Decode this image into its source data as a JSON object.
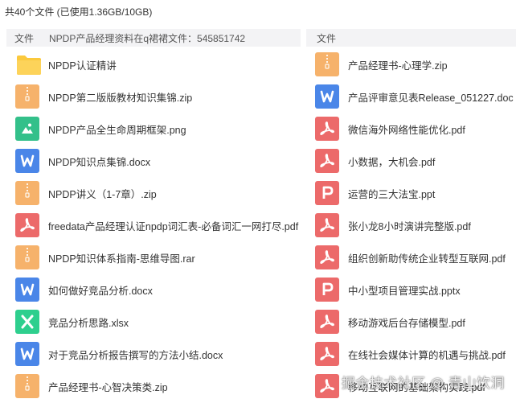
{
  "summary": "共40个文件 (已使用1.36GB/10GB)",
  "left_header": {
    "label": "文件",
    "overlay": "NPDP产品经理资料在q裙裙文件：545851742"
  },
  "right_header": {
    "label": "文件"
  },
  "left_files": [
    {
      "name": "NPDP认证精讲",
      "type": "folder"
    },
    {
      "name": "NPDP第二版版教材知识集锦.zip",
      "type": "zip"
    },
    {
      "name": "NPDP产品全生命周期框架.png",
      "type": "png"
    },
    {
      "name": "NPDP知识点集锦.docx",
      "type": "word"
    },
    {
      "name": "NPDP讲义（1-7章）.zip",
      "type": "zip"
    },
    {
      "name": "freedata产品经理认证npdp词汇表-必备词汇一网打尽.pdf",
      "type": "pdf"
    },
    {
      "name": "NPDP知识体系指南-思维导图.rar",
      "type": "zip"
    },
    {
      "name": "如何做好竞品分析.docx",
      "type": "word"
    },
    {
      "name": "竞品分析思路.xlsx",
      "type": "xls"
    },
    {
      "name": "对于竞品分析报告撰写的方法小结.docx",
      "type": "word"
    },
    {
      "name": "产品经理书-心智决策类.zip",
      "type": "zip"
    }
  ],
  "right_files": [
    {
      "name": "产品经理书-心理学.zip",
      "type": "zip"
    },
    {
      "name": "产品评审意见表Release_051227.doc",
      "type": "word"
    },
    {
      "name": "微信海外网络性能优化.pdf",
      "type": "pdf"
    },
    {
      "name": "小数据，大机会.pdf",
      "type": "pdf"
    },
    {
      "name": "运营的三大法宝.ppt",
      "type": "ppt"
    },
    {
      "name": "张小龙8小时演讲完整版.pdf",
      "type": "pdf"
    },
    {
      "name": "组织创新助传统企业转型互联网.pdf",
      "type": "pdf"
    },
    {
      "name": "中小型项目管理实战.pptx",
      "type": "ppt"
    },
    {
      "name": "移动游戏后台存储模型.pdf",
      "type": "pdf"
    },
    {
      "name": "在线社会媒体计算的机遇与挑战.pdf",
      "type": "pdf"
    },
    {
      "name": "移动互联网的基础架构实践.pdf",
      "type": "pdf"
    }
  ],
  "watermark": "掘金技术社区 @ 青山饮洞",
  "colors": {
    "zip": "#f6b26b",
    "word": "#4a86e8",
    "pdf": "#ec6a6a",
    "png": "#33c08a",
    "xls": "#2ecf8e",
    "folder": "#fcd25c"
  }
}
